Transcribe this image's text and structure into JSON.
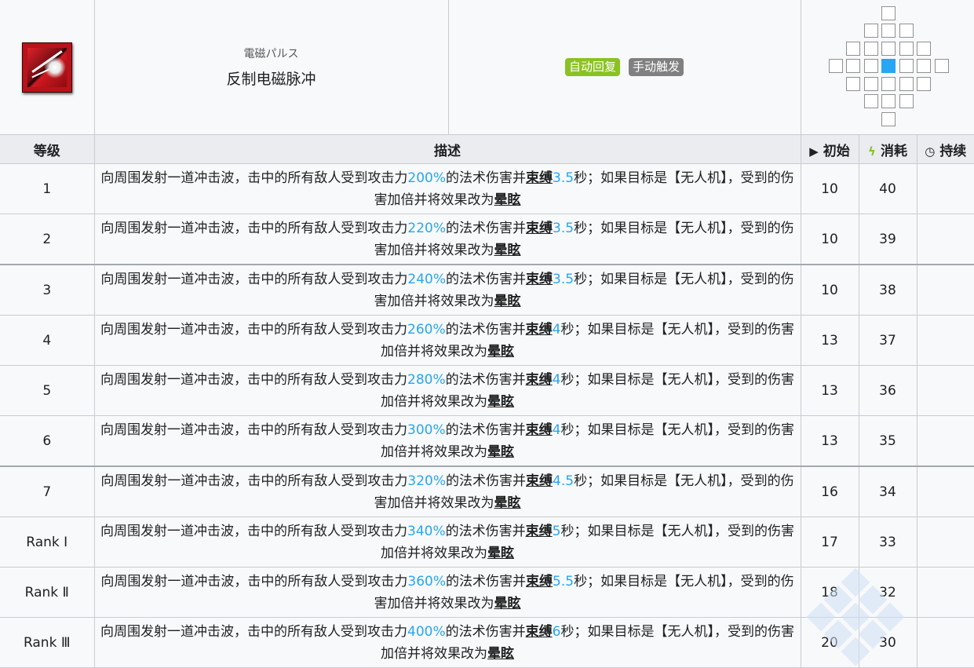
{
  "skill": {
    "icon": "electromagnetic-pulse-icon",
    "name_jp": "電磁パルス",
    "name_cn": "反制电磁脉冲",
    "recovery_tag": "自动回复",
    "trigger_tag": "手动触发"
  },
  "range": {
    "grid": [
      [
        0,
        0,
        0,
        1,
        0,
        0,
        0
      ],
      [
        0,
        0,
        1,
        1,
        1,
        0,
        0
      ],
      [
        0,
        1,
        1,
        1,
        1,
        1,
        0
      ],
      [
        1,
        1,
        1,
        2,
        1,
        1,
        1
      ],
      [
        0,
        1,
        1,
        1,
        1,
        1,
        0
      ],
      [
        0,
        0,
        1,
        1,
        1,
        0,
        0
      ],
      [
        0,
        0,
        0,
        1,
        0,
        0,
        0
      ]
    ]
  },
  "headers": {
    "level": "等级",
    "description": "描述",
    "initial": "初始",
    "cost": "消耗",
    "duration": "持续"
  },
  "levels": [
    {
      "level": "1",
      "pre": "向周围发射一道冲击波，击中的所有敌人受到攻击力",
      "damage": "200%",
      "mid": "的法术伤害并",
      "bind": "束缚",
      "seconds": "3.5",
      "post": "秒；如果目标是【无人机】，受到的伤害加倍并将效果改为",
      "effect": "晕眩",
      "initial": "10",
      "cost": "40",
      "duration": ""
    },
    {
      "level": "2",
      "pre": "向周围发射一道冲击波，击中的所有敌人受到攻击力",
      "damage": "220%",
      "mid": "的法术伤害并",
      "bind": "束缚",
      "seconds": "3.5",
      "post": "秒；如果目标是【无人机】，受到的伤害加倍并将效果改为",
      "effect": "晕眩",
      "initial": "10",
      "cost": "39",
      "duration": ""
    },
    {
      "level": "3",
      "pre": "向周围发射一道冲击波，击中的所有敌人受到攻击力",
      "damage": "240%",
      "mid": "的法术伤害并",
      "bind": "束缚",
      "seconds": "3.5",
      "post": "秒；如果目标是【无人机】，受到的伤害加倍并将效果改为",
      "effect": "晕眩",
      "initial": "10",
      "cost": "38",
      "duration": ""
    },
    {
      "level": "4",
      "pre": "向周围发射一道冲击波，击中的所有敌人受到攻击力",
      "damage": "260%",
      "mid": "的法术伤害并",
      "bind": "束缚",
      "seconds": "4",
      "post": "秒；如果目标是【无人机】，受到的伤害加倍并将效果改为",
      "effect": "晕眩",
      "initial": "13",
      "cost": "37",
      "duration": ""
    },
    {
      "level": "5",
      "pre": "向周围发射一道冲击波，击中的所有敌人受到攻击力",
      "damage": "280%",
      "mid": "的法术伤害并",
      "bind": "束缚",
      "seconds": "4",
      "post": "秒；如果目标是【无人机】，受到的伤害加倍并将效果改为",
      "effect": "晕眩",
      "initial": "13",
      "cost": "36",
      "duration": ""
    },
    {
      "level": "6",
      "pre": "向周围发射一道冲击波，击中的所有敌人受到攻击力",
      "damage": "300%",
      "mid": "的法术伤害并",
      "bind": "束缚",
      "seconds": "4",
      "post": "秒；如果目标是【无人机】，受到的伤害加倍并将效果改为",
      "effect": "晕眩",
      "initial": "13",
      "cost": "35",
      "duration": ""
    },
    {
      "level": "7",
      "pre": "向周围发射一道冲击波，击中的所有敌人受到攻击力",
      "damage": "320%",
      "mid": "的法术伤害并",
      "bind": "束缚",
      "seconds": "4.5",
      "post": "秒；如果目标是【无人机】，受到的伤害加倍并将效果改为",
      "effect": "晕眩",
      "initial": "16",
      "cost": "34",
      "duration": ""
    },
    {
      "level": "Rank Ⅰ",
      "pre": "向周围发射一道冲击波，击中的所有敌人受到攻击力",
      "damage": "340%",
      "mid": "的法术伤害并",
      "bind": "束缚",
      "seconds": "5",
      "post": "秒；如果目标是【无人机】，受到的伤害加倍并将效果改为",
      "effect": "晕眩",
      "initial": "17",
      "cost": "33",
      "duration": ""
    },
    {
      "level": "Rank Ⅱ",
      "pre": "向周围发射一道冲击波，击中的所有敌人受到攻击力",
      "damage": "360%",
      "mid": "的法术伤害并",
      "bind": "束缚",
      "seconds": "5.5",
      "post": "秒；如果目标是【无人机】，受到的伤害加倍并将效果改为",
      "effect": "晕眩",
      "initial": "18",
      "cost": "32",
      "duration": ""
    },
    {
      "level": "Rank Ⅲ",
      "pre": "向周围发射一道冲击波，击中的所有敌人受到攻击力",
      "damage": "400%",
      "mid": "的法术伤害并",
      "bind": "束缚",
      "seconds": "6",
      "post": "秒；如果目标是【无人机】，受到的伤害加倍并将效果改为",
      "effect": "晕眩",
      "initial": "20",
      "cost": "30",
      "duration": ""
    }
  ],
  "colors": {
    "highlight": "#27a6f3",
    "auto_tag": "#8ac222",
    "manual_tag": "#808080",
    "range_self": "#27a6f3"
  }
}
